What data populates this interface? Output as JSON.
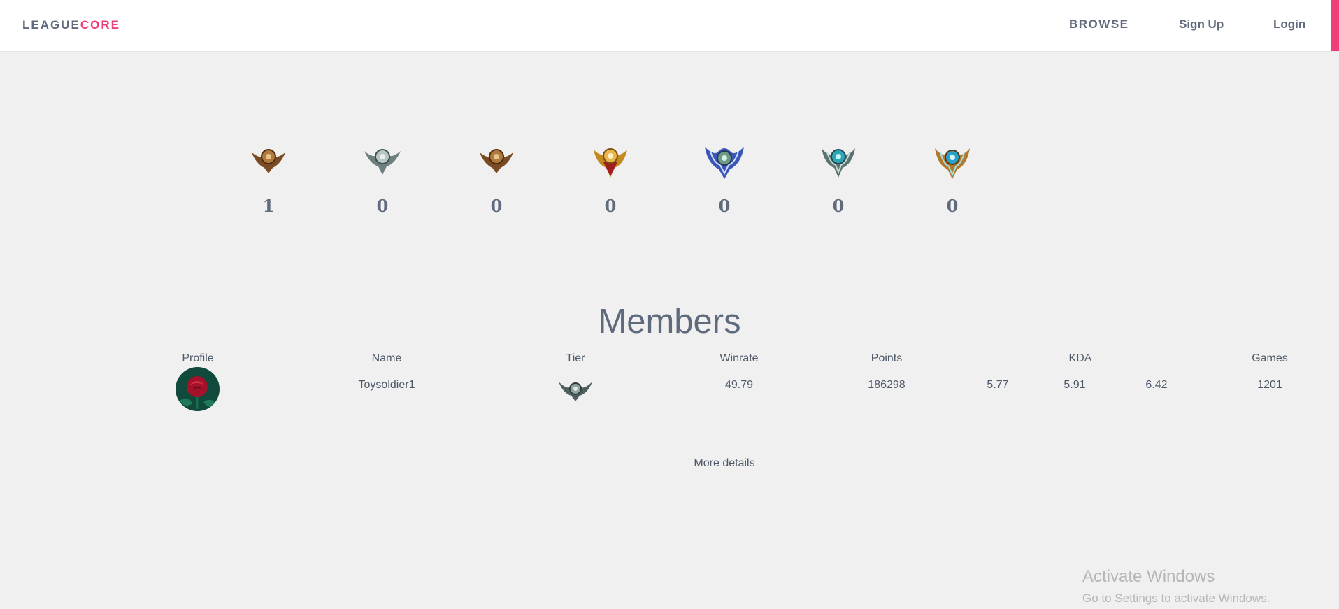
{
  "nav": {
    "brand_part1": "LEAGUE",
    "brand_part2": "CORE",
    "browse": "BROWSE",
    "signup": "Sign Up",
    "login": "Login",
    "accent_color": "#ef3f78"
  },
  "ranks": [
    {
      "icon": "bronze-emblem-icon",
      "count": "1"
    },
    {
      "icon": "silver-emblem-icon",
      "count": "0"
    },
    {
      "icon": "bronze-emblem-icon",
      "count": "0"
    },
    {
      "icon": "gold-emblem-icon",
      "count": "0"
    },
    {
      "icon": "diamond-emblem-icon",
      "count": "0"
    },
    {
      "icon": "master-emblem-icon",
      "count": "0"
    },
    {
      "icon": "challenger-emblem-icon",
      "count": "0"
    }
  ],
  "members": {
    "title": "Members",
    "headers": {
      "profile": "Profile",
      "name": "Name",
      "tier": "Tier",
      "winrate": "Winrate",
      "points": "Points",
      "kda": "KDA",
      "games": "Games"
    },
    "rows": [
      {
        "avatar": "rose-avatar",
        "name": "Toysoldier1",
        "tier_icon": "silver-emblem-icon",
        "winrate": "49.79",
        "points": "186298",
        "kda_kills": "5.77",
        "kda_deaths": "5.91",
        "kda_assists": "6.42",
        "games": "1201"
      }
    ],
    "more_details": "More details"
  },
  "windows_watermark": {
    "title": "Activate Windows",
    "subtitle": "Go to Settings to activate Windows."
  }
}
